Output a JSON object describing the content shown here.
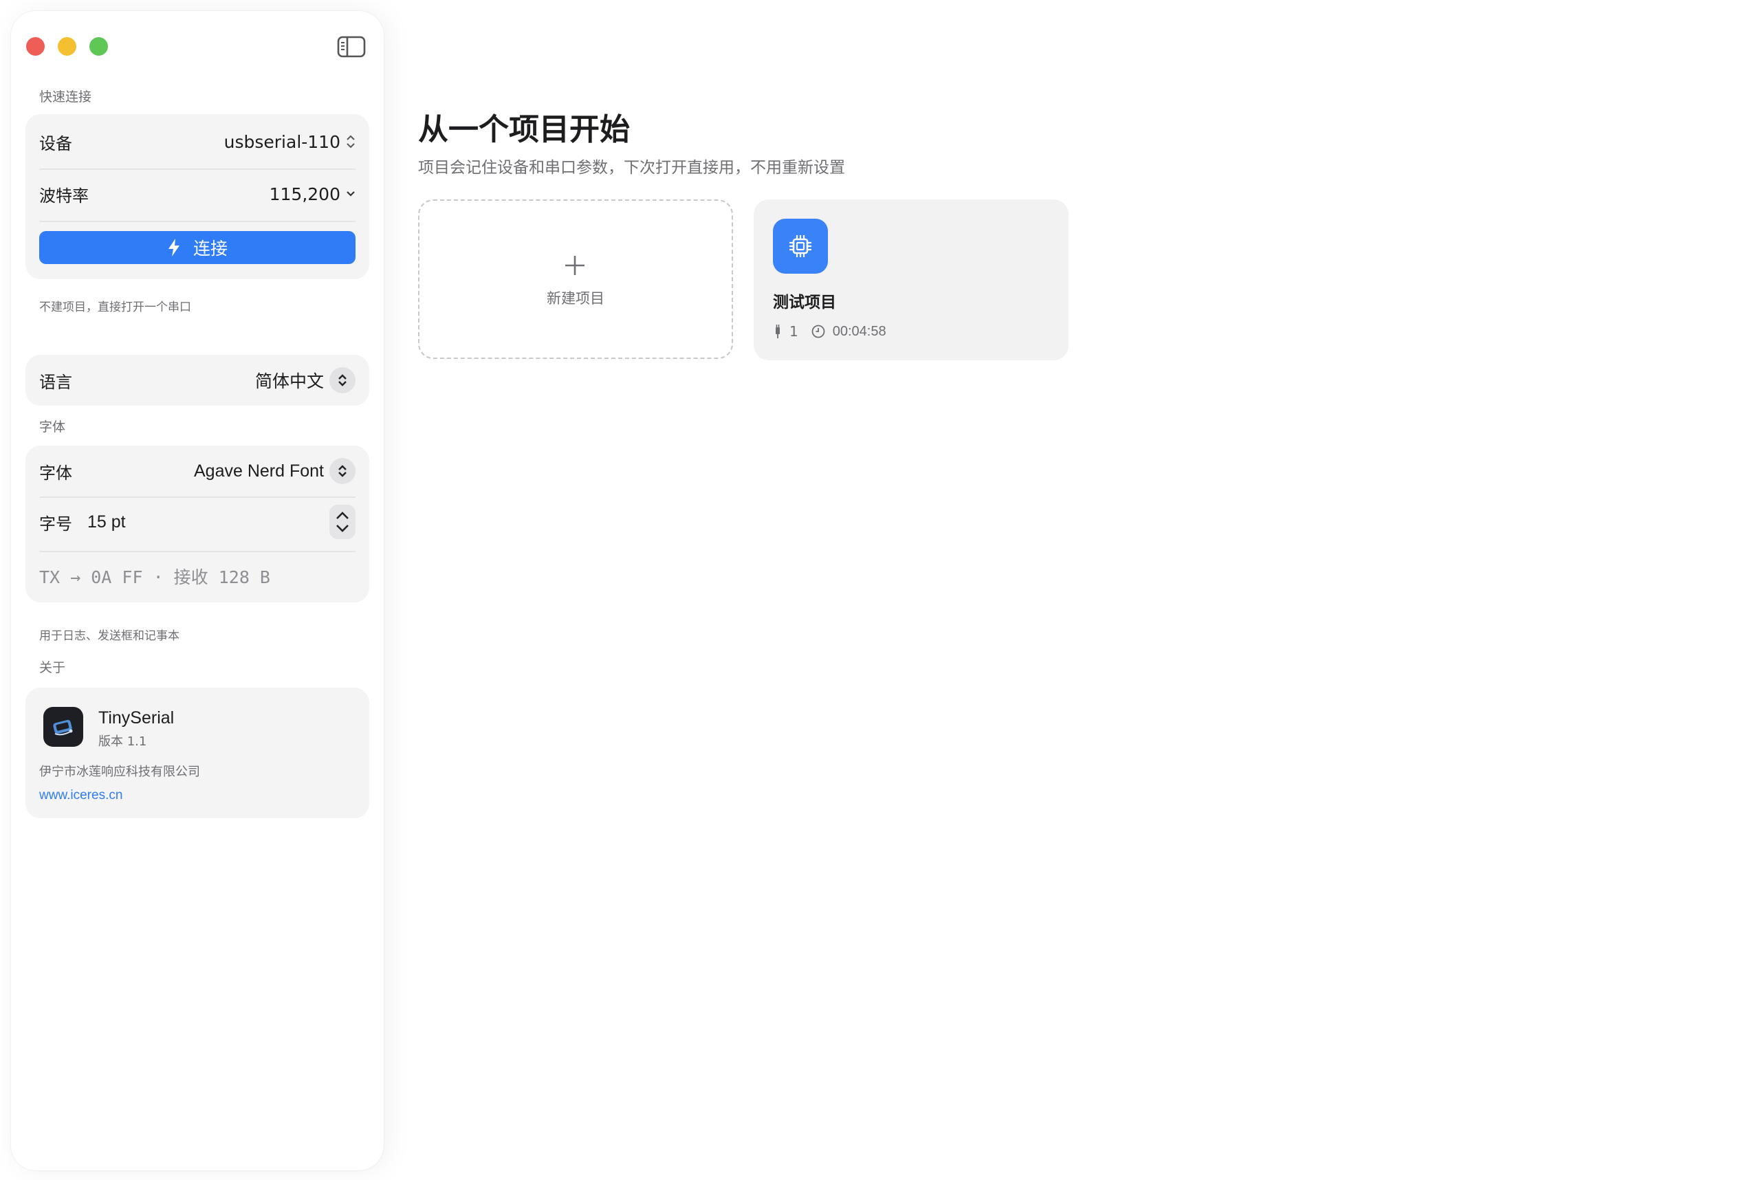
{
  "sidebar": {
    "quick_connect": {
      "section_title": "快速连接",
      "device_label": "设备",
      "device_value": "usbserial-110",
      "baud_label": "波特率",
      "baud_value": "115,200",
      "connect_button": "连接",
      "note": "不建项目，直接打开一个串口"
    },
    "language": {
      "label": "语言",
      "value": "简体中文"
    },
    "font": {
      "section_title": "字体",
      "font_label": "字体",
      "font_value": "Agave Nerd Font",
      "size_label": "字号",
      "size_value": "15 pt",
      "preview": "TX → 0A FF · 接收 128 B",
      "note": "用于日志、发送框和记事本"
    },
    "about": {
      "section_title": "关于",
      "app_name": "TinySerial",
      "version": "版本 1.1",
      "company": "伊宁市冰莲响应科技有限公司",
      "website": "www.iceres.cn"
    }
  },
  "main": {
    "title": "从一个项目开始",
    "subtitle": "项目会记住设备和串口参数，下次打开直接用，不用重新设置",
    "new_project_label": "新建项目",
    "projects": [
      {
        "name": "测试项目",
        "devices": "1",
        "duration": "00:04:58"
      }
    ]
  },
  "colors": {
    "accent": "#2f7cf6",
    "close": "#ee5e56",
    "minimize": "#f5c02f",
    "maximize": "#5fc755",
    "group_bg": "#f4f4f5"
  },
  "icons": [
    "sidebar-toggle-icon",
    "bolt-icon",
    "chevron-updown-icon",
    "chevron-down-icon",
    "plus-icon",
    "chip-icon",
    "plug-icon",
    "clock-icon",
    "app-logo-icon"
  ]
}
